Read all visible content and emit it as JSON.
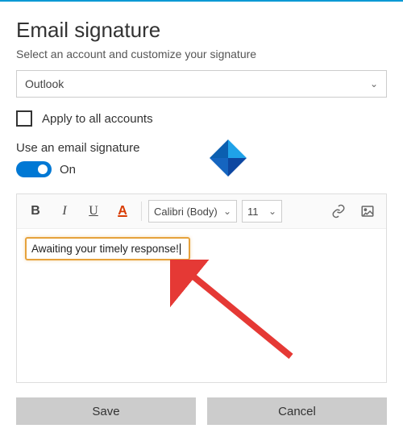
{
  "header": {
    "title": "Email signature",
    "subtitle": "Select an account and customize your signature"
  },
  "account": {
    "selected": "Outlook"
  },
  "apply_all": {
    "label": "Apply to all accounts",
    "checked": false
  },
  "use_signature": {
    "label": "Use an email signature",
    "state_label": "On",
    "on": true
  },
  "toolbar": {
    "bold": "B",
    "italic": "I",
    "underline": "U",
    "color": "A",
    "font": "Calibri (Body)",
    "size": "11"
  },
  "editor": {
    "content": "Awaiting your timely response!"
  },
  "footer": {
    "save": "Save",
    "cancel": "Cancel"
  }
}
